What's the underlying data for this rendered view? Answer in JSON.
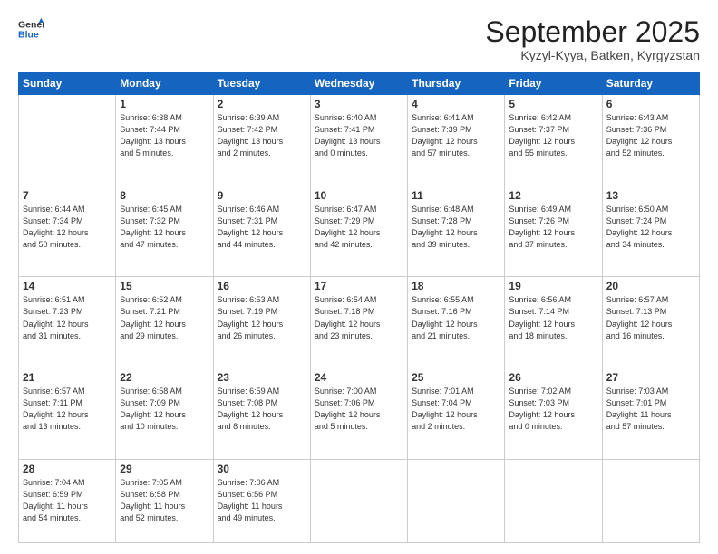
{
  "header": {
    "logo_line1": "General",
    "logo_line2": "Blue",
    "month": "September 2025",
    "location": "Kyzyl-Kyya, Batken, Kyrgyzstan"
  },
  "weekdays": [
    "Sunday",
    "Monday",
    "Tuesday",
    "Wednesday",
    "Thursday",
    "Friday",
    "Saturday"
  ],
  "weeks": [
    [
      {
        "day": "",
        "info": ""
      },
      {
        "day": "1",
        "info": "Sunrise: 6:38 AM\nSunset: 7:44 PM\nDaylight: 13 hours\nand 5 minutes."
      },
      {
        "day": "2",
        "info": "Sunrise: 6:39 AM\nSunset: 7:42 PM\nDaylight: 13 hours\nand 2 minutes."
      },
      {
        "day": "3",
        "info": "Sunrise: 6:40 AM\nSunset: 7:41 PM\nDaylight: 13 hours\nand 0 minutes."
      },
      {
        "day": "4",
        "info": "Sunrise: 6:41 AM\nSunset: 7:39 PM\nDaylight: 12 hours\nand 57 minutes."
      },
      {
        "day": "5",
        "info": "Sunrise: 6:42 AM\nSunset: 7:37 PM\nDaylight: 12 hours\nand 55 minutes."
      },
      {
        "day": "6",
        "info": "Sunrise: 6:43 AM\nSunset: 7:36 PM\nDaylight: 12 hours\nand 52 minutes."
      }
    ],
    [
      {
        "day": "7",
        "info": "Sunrise: 6:44 AM\nSunset: 7:34 PM\nDaylight: 12 hours\nand 50 minutes."
      },
      {
        "day": "8",
        "info": "Sunrise: 6:45 AM\nSunset: 7:32 PM\nDaylight: 12 hours\nand 47 minutes."
      },
      {
        "day": "9",
        "info": "Sunrise: 6:46 AM\nSunset: 7:31 PM\nDaylight: 12 hours\nand 44 minutes."
      },
      {
        "day": "10",
        "info": "Sunrise: 6:47 AM\nSunset: 7:29 PM\nDaylight: 12 hours\nand 42 minutes."
      },
      {
        "day": "11",
        "info": "Sunrise: 6:48 AM\nSunset: 7:28 PM\nDaylight: 12 hours\nand 39 minutes."
      },
      {
        "day": "12",
        "info": "Sunrise: 6:49 AM\nSunset: 7:26 PM\nDaylight: 12 hours\nand 37 minutes."
      },
      {
        "day": "13",
        "info": "Sunrise: 6:50 AM\nSunset: 7:24 PM\nDaylight: 12 hours\nand 34 minutes."
      }
    ],
    [
      {
        "day": "14",
        "info": "Sunrise: 6:51 AM\nSunset: 7:23 PM\nDaylight: 12 hours\nand 31 minutes."
      },
      {
        "day": "15",
        "info": "Sunrise: 6:52 AM\nSunset: 7:21 PM\nDaylight: 12 hours\nand 29 minutes."
      },
      {
        "day": "16",
        "info": "Sunrise: 6:53 AM\nSunset: 7:19 PM\nDaylight: 12 hours\nand 26 minutes."
      },
      {
        "day": "17",
        "info": "Sunrise: 6:54 AM\nSunset: 7:18 PM\nDaylight: 12 hours\nand 23 minutes."
      },
      {
        "day": "18",
        "info": "Sunrise: 6:55 AM\nSunset: 7:16 PM\nDaylight: 12 hours\nand 21 minutes."
      },
      {
        "day": "19",
        "info": "Sunrise: 6:56 AM\nSunset: 7:14 PM\nDaylight: 12 hours\nand 18 minutes."
      },
      {
        "day": "20",
        "info": "Sunrise: 6:57 AM\nSunset: 7:13 PM\nDaylight: 12 hours\nand 16 minutes."
      }
    ],
    [
      {
        "day": "21",
        "info": "Sunrise: 6:57 AM\nSunset: 7:11 PM\nDaylight: 12 hours\nand 13 minutes."
      },
      {
        "day": "22",
        "info": "Sunrise: 6:58 AM\nSunset: 7:09 PM\nDaylight: 12 hours\nand 10 minutes."
      },
      {
        "day": "23",
        "info": "Sunrise: 6:59 AM\nSunset: 7:08 PM\nDaylight: 12 hours\nand 8 minutes."
      },
      {
        "day": "24",
        "info": "Sunrise: 7:00 AM\nSunset: 7:06 PM\nDaylight: 12 hours\nand 5 minutes."
      },
      {
        "day": "25",
        "info": "Sunrise: 7:01 AM\nSunset: 7:04 PM\nDaylight: 12 hours\nand 2 minutes."
      },
      {
        "day": "26",
        "info": "Sunrise: 7:02 AM\nSunset: 7:03 PM\nDaylight: 12 hours\nand 0 minutes."
      },
      {
        "day": "27",
        "info": "Sunrise: 7:03 AM\nSunset: 7:01 PM\nDaylight: 11 hours\nand 57 minutes."
      }
    ],
    [
      {
        "day": "28",
        "info": "Sunrise: 7:04 AM\nSunset: 6:59 PM\nDaylight: 11 hours\nand 54 minutes."
      },
      {
        "day": "29",
        "info": "Sunrise: 7:05 AM\nSunset: 6:58 PM\nDaylight: 11 hours\nand 52 minutes."
      },
      {
        "day": "30",
        "info": "Sunrise: 7:06 AM\nSunset: 6:56 PM\nDaylight: 11 hours\nand 49 minutes."
      },
      {
        "day": "",
        "info": ""
      },
      {
        "day": "",
        "info": ""
      },
      {
        "day": "",
        "info": ""
      },
      {
        "day": "",
        "info": ""
      }
    ]
  ]
}
